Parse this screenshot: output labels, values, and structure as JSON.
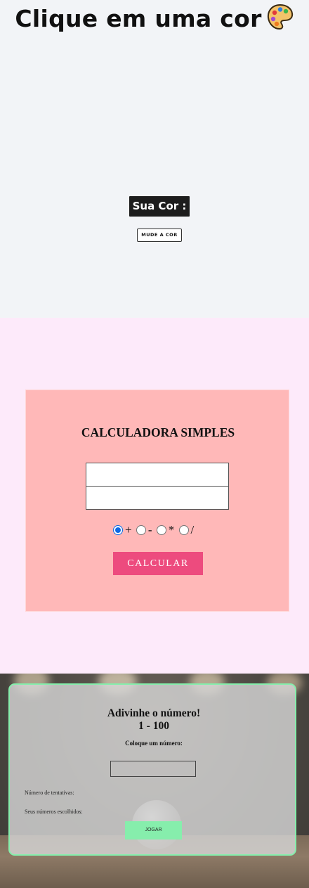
{
  "color_picker": {
    "title": "Clique em uma cor",
    "title_icon": "artist-palette-icon",
    "your_color_label": "Sua Cor :",
    "change_button_label": "MUDE A COR",
    "background": "#f2f4f7"
  },
  "calculator": {
    "title": "CALCULADORA SIMPLES",
    "input_one_value": "",
    "input_two_value": "",
    "operations": [
      {
        "symbol": "+",
        "selected": true
      },
      {
        "symbol": "-",
        "selected": false
      },
      {
        "symbol": "*",
        "selected": false
      },
      {
        "symbol": "/",
        "selected": false
      }
    ],
    "button_label": "CALCULAR",
    "colors": {
      "section_bg": "#fdeafa",
      "box_bg": "#ffb8b8",
      "button_bg": "#ed4b7e"
    }
  },
  "guess_game": {
    "title": "Adivinhe o número!",
    "range": "1 - 100",
    "prompt": "Coloque um número:",
    "input_value": "",
    "attempts_label": "Número de tentativas:",
    "chosen_label": "Seus números escolhidos:",
    "button_label": "JOGAR",
    "accent_color": "#86eeac"
  }
}
